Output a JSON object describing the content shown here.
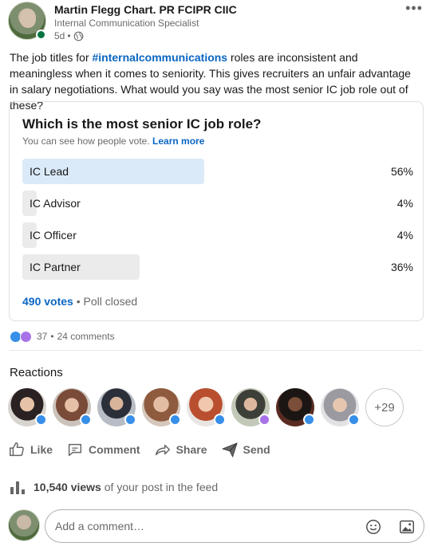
{
  "post": {
    "author_name": "Martin Flegg Chart. PR FCIPR CIIC",
    "author_title": "Internal Communication Specialist",
    "age": "5d",
    "meta_sep": "•",
    "text_before": "The job titles for ",
    "hashtag": "#internalcommunications",
    "text_after": " roles are inconsistent and meaningless when it comes to seniority. This gives recruiters an unfair advantage in salary negotiations. What would you say was the most senior IC job role out of these?"
  },
  "poll": {
    "question": "Which is the most senior IC job role?",
    "visibility_note": "You can see how people vote.",
    "learn_more": "Learn more",
    "options": [
      {
        "label": "IC Lead",
        "percent": "56%",
        "share": 0.56
      },
      {
        "label": "IC Advisor",
        "percent": "4%",
        "share": 0.04
      },
      {
        "label": "IC Officer",
        "percent": "4%",
        "share": 0.04
      },
      {
        "label": "IC Partner",
        "percent": "36%",
        "share": 0.36
      }
    ],
    "votes": "490 votes",
    "status": "Poll closed",
    "footer_sep": "•"
  },
  "social": {
    "reaction_count": "37",
    "sep": "•",
    "comments": "24 comments"
  },
  "reactions": {
    "title": "Reactions",
    "more_count": "+29"
  },
  "actions": {
    "like": "Like",
    "comment": "Comment",
    "share": "Share",
    "send": "Send"
  },
  "analytics": {
    "views": "10,540 views",
    "views_suffix": " of your post in the feed"
  },
  "comment_box": {
    "placeholder": "Add a comment…"
  },
  "colors": {
    "accent": "#0a66c2",
    "top_option_bar": "#dbeaf8",
    "option_bar": "#ebebeb",
    "like_reaction": "#378fe9",
    "curious_reaction": "#a872e8",
    "online": "#057642"
  }
}
